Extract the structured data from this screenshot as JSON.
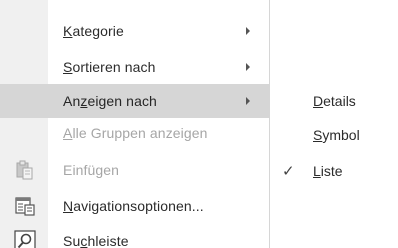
{
  "context_menu": {
    "items": [
      {
        "label_pre": "",
        "label_u": "K",
        "label_post": "ategorie",
        "has_submenu": true,
        "state": "normal",
        "icon": ""
      },
      {
        "label_pre": "",
        "label_u": "S",
        "label_post": "ortieren nach",
        "has_submenu": true,
        "state": "normal",
        "icon": ""
      },
      {
        "label_pre": "An",
        "label_u": "z",
        "label_post": "eigen nach",
        "has_submenu": true,
        "state": "highlighted",
        "icon": ""
      },
      {
        "label_pre": "",
        "label_u": "A",
        "label_post": "lle Gruppen anzeigen",
        "has_submenu": false,
        "state": "disabled",
        "icon": ""
      },
      {
        "label_pre": "Einfügen",
        "label_u": "",
        "label_post": "",
        "has_submenu": false,
        "state": "disabled",
        "icon": "paste-icon"
      },
      {
        "label_pre": "",
        "label_u": "N",
        "label_post": "avigationsoptionen...",
        "has_submenu": false,
        "state": "normal",
        "icon": "navigation-options-icon"
      },
      {
        "label_pre": "Su",
        "label_u": "c",
        "label_post": "hleiste",
        "has_submenu": false,
        "state": "normal",
        "icon": "search-icon"
      }
    ]
  },
  "submenu": {
    "parent": "Anzeigen nach",
    "items": [
      {
        "label_pre": "",
        "label_u": "D",
        "label_post": "etails",
        "checked": false
      },
      {
        "label_pre": "",
        "label_u": "S",
        "label_post": "ymbol",
        "checked": false
      },
      {
        "label_pre": "",
        "label_u": "L",
        "label_post": "iste",
        "checked": true
      }
    ],
    "check_glyph": "✓"
  },
  "colors": {
    "highlight": "#d6d6d6",
    "gutter": "#f0f0f0",
    "text": "#2b2b2b",
    "disabled_text": "#a6a6a6"
  }
}
